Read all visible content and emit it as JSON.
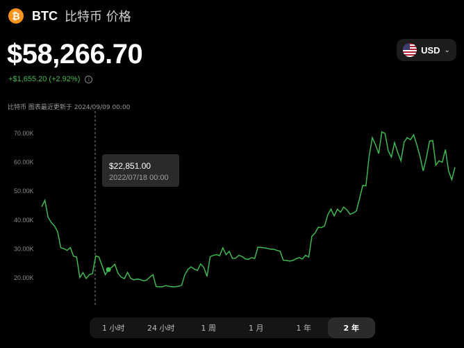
{
  "header": {
    "coin_icon": "bitcoin-icon",
    "coin_glyph": "₿",
    "symbol": "BTC",
    "title": "比特币 价格"
  },
  "price": {
    "current": "$58,266.70",
    "change": "+$1,655.20 (+2.92%)"
  },
  "updated_text": "比特币 图表最近更新于 2024/09/09 00:00",
  "currency": {
    "label": "USD",
    "flag_icon": "us-flag-icon",
    "chevron_icon": "chevron-down-icon"
  },
  "tooltip": {
    "price": "$22,851.00",
    "date": "2022/07/18 00:00"
  },
  "range_tabs": [
    "1 小时",
    "24 小时",
    "1 周",
    "1 月",
    "1 年",
    "2 年"
  ],
  "active_range": "2 年",
  "colors": {
    "line": "#3fb950",
    "positive": "#3fb950",
    "brand": "#f7931a"
  },
  "chart_data": {
    "type": "line",
    "title": "",
    "xlabel": "",
    "ylabel": "",
    "x_range": [
      "2022/09",
      "2024/09/09"
    ],
    "ylim": [
      10000,
      75000
    ],
    "y_ticks": [
      20000,
      30000,
      40000,
      50000,
      60000,
      70000
    ],
    "y_tick_labels": [
      "20.00K",
      "30.00K",
      "40.00K",
      "50.00K",
      "60.00K",
      "70.00K"
    ],
    "grid": false,
    "highlight": {
      "index": 21,
      "value": 22851,
      "date": "2022/07/18 00:00"
    },
    "values": [
      44600,
      46800,
      41000,
      39200,
      38000,
      36000,
      30400,
      30100,
      29500,
      30500,
      27500,
      27200,
      20100,
      21800,
      19800,
      21100,
      21500,
      27600,
      27200,
      24200,
      21100,
      22851,
      23600,
      24700,
      21600,
      20300,
      19700,
      21900,
      19800,
      19300,
      19600,
      19400,
      19000,
      19200,
      20200,
      21100,
      17000,
      16900,
      16900,
      17300,
      17100,
      16900,
      16900,
      17100,
      17400,
      21000,
      22900,
      23800,
      23000,
      22600,
      24800,
      23600,
      20500,
      27300,
      27800,
      28000,
      27700,
      30400,
      28000,
      29200,
      26700,
      26800,
      27800,
      27400,
      26600,
      26400,
      27000,
      26700,
      30600,
      30500,
      30400,
      30200,
      29900,
      29900,
      29500,
      29200,
      26100,
      26000,
      25800,
      26000,
      26600,
      27000,
      26500,
      27800,
      27200,
      34400,
      35500,
      37500,
      37400,
      38000,
      41800,
      43800,
      41400,
      43800,
      42700,
      44500,
      43500,
      42000,
      42400,
      43200,
      47500,
      52000,
      51800,
      62000,
      68500,
      66000,
      63000,
      70500,
      70000,
      64000,
      61800,
      66800,
      63400,
      60500,
      67000,
      68500,
      67800,
      69500,
      66000,
      62000,
      57000,
      61500,
      67300,
      67500,
      59000,
      60500,
      60000,
      64400,
      57000,
      54000,
      58266.7
    ]
  }
}
